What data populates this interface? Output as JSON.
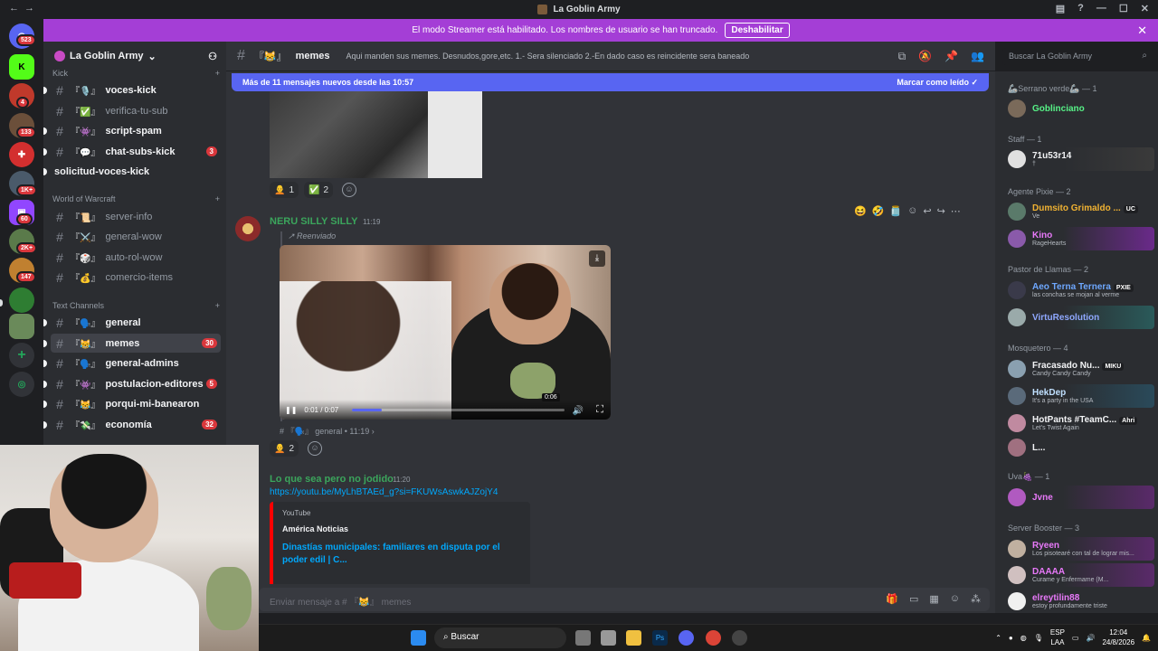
{
  "window": {
    "title": "La Goblin Army"
  },
  "banner": {
    "text": "El modo Streamer está habilitado. Los nombres de usuario se han truncado.",
    "button": "Deshabilitar"
  },
  "servers": [
    {
      "badge": "523",
      "color": "#5865f2"
    },
    {
      "badge": "",
      "color": "#53fc18"
    },
    {
      "badge": "4",
      "color": "#c0392b"
    },
    {
      "badge": "133",
      "color": "#6b4f3a"
    },
    {
      "badge": "",
      "color": "#d32f2f"
    },
    {
      "badge": "1K+",
      "color": "#4a5a6a"
    },
    {
      "badge": "60",
      "color": "#9146ff"
    },
    {
      "badge": "2K+",
      "color": "#5a7a4a"
    },
    {
      "badge": "147",
      "color": "#c08030"
    },
    {
      "badge": "",
      "color": "#2e7d32"
    },
    {
      "badge": "",
      "color": "#6a8a5a"
    }
  ],
  "guild": {
    "name": "La Goblin Army"
  },
  "sidebar": {
    "cat_kick": "Kick",
    "cat_wow": "World of Warcraft",
    "cat_text": "Text Channels",
    "channels": [
      {
        "emoji": "『🎙️』",
        "name": "voces-kick",
        "count": ""
      },
      {
        "emoji": "『✅』",
        "name": "verifica-tu-sub",
        "count": ""
      },
      {
        "emoji": "『👾』",
        "name": "script-spam",
        "count": ""
      },
      {
        "emoji": "『💬』",
        "name": "chat-subs-kick",
        "count": "3"
      },
      {
        "emoji": "",
        "name": "solicitud-voces-kick",
        "count": ""
      },
      {
        "emoji": "『📜』",
        "name": "server-info",
        "count": ""
      },
      {
        "emoji": "『⚔️』",
        "name": "general-wow",
        "count": ""
      },
      {
        "emoji": "『🎲』",
        "name": "auto-rol-wow",
        "count": ""
      },
      {
        "emoji": "『💰』",
        "name": "comercio-items",
        "count": ""
      },
      {
        "emoji": "『🗣️』",
        "name": "general",
        "count": ""
      },
      {
        "emoji": "『😹』",
        "name": "memes",
        "count": "30"
      },
      {
        "emoji": "『🗣️』",
        "name": "general-admins",
        "count": ""
      },
      {
        "emoji": "『👾』",
        "name": "postulacion-editores",
        "count": "5"
      },
      {
        "emoji": "『😹』",
        "name": "porqui-mi-banearon",
        "count": ""
      },
      {
        "emoji": "『💸』",
        "name": "economía",
        "count": "32"
      }
    ]
  },
  "channel_header": {
    "emoji": "『😹』",
    "name": "memes",
    "topic": "Aqui manden sus memes. Desnudos,gore,etc. 1.- Sera silenciado 2.-En dado caso es reincidente sera baneado",
    "search_placeholder": "Buscar La Goblin Army"
  },
  "new_messages": {
    "text": "Más de 11 mensajes nuevos desde las 10:57",
    "action": "Marcar como leído"
  },
  "messages": {
    "m1_reactions": [
      {
        "emoji": "🧑‍🦲",
        "count": "1"
      },
      {
        "emoji": "✅",
        "count": "2"
      }
    ],
    "m2": {
      "author": "NERU SILLY SILLY",
      "author_color": "#3ba55c",
      "time": "11:19",
      "forwarded": "Reenviado",
      "video_time": "0:01 / 0:07",
      "video_progress": 0.14,
      "video_tooltip": "0:06",
      "source_channel": "general",
      "source_time": "11:19",
      "reaction_count": "2"
    },
    "m3": {
      "author": "Lo que sea pero no jodido",
      "author_color": "#3ba55c",
      "time": "11:20",
      "link": "https://youtu.be/MyLhBTAEd_g?si=FKUWsAswkAJZojY4",
      "embed_provider": "YouTube",
      "embed_author": "América Noticias",
      "embed_title": "Dinastías municipales: familiares en disputa por el poder edil | C..."
    }
  },
  "composer": {
    "placeholder": "Enviar mensaje a # 『😹』 memes"
  },
  "members": {
    "groups": [
      {
        "title": "🦾Serrano verde🦾 — 1",
        "members": [
          {
            "name": "Goblinciano",
            "color": "#57f287",
            "status": "",
            "tag": ""
          }
        ]
      },
      {
        "title": "Staff — 1",
        "members": [
          {
            "name": "71u53r14",
            "color": "#f2f3f5",
            "status": "†",
            "tag": ""
          }
        ]
      },
      {
        "title": "Agente Pixie — 2",
        "members": [
          {
            "name": "Dumsito Grimaldo ...",
            "color": "#f0b232",
            "status": "Ve",
            "tag": "UC"
          },
          {
            "name": "Kino",
            "color": "#e879f9",
            "status": "RageHearts",
            "tag": ""
          }
        ]
      },
      {
        "title": "Pastor de Llamas — 2",
        "members": [
          {
            "name": "Aeo Terna Ternera",
            "color": "#6ea8ff",
            "status": "las conchas se mojan al verme",
            "tag": "PXIE"
          },
          {
            "name": "VirtuResolution",
            "color": "#8fa8ff",
            "status": "",
            "tag": ""
          }
        ]
      },
      {
        "title": "Mosquetero — 4",
        "members": [
          {
            "name": "Fracasado Nu...",
            "color": "#f2f3f5",
            "status": "Candy Candy Candy",
            "tag": "MIKU"
          },
          {
            "name": "HekDep",
            "color": "#c0e0ff",
            "status": "It's a party in the USA",
            "tag": ""
          },
          {
            "name": "HotPants #TeamC...",
            "color": "#f2f3f5",
            "status": "Let's Twist Again",
            "tag": "Ahri"
          },
          {
            "name": "L...",
            "color": "#f2f3f5",
            "status": "",
            "tag": ""
          }
        ]
      },
      {
        "title": "Uva🍇 — 1",
        "members": [
          {
            "name": "Jvne",
            "color": "#e879f9",
            "status": "",
            "tag": ""
          }
        ]
      },
      {
        "title": "Server Booster — 3",
        "members": [
          {
            "name": "Ryeen",
            "color": "#e879f9",
            "status": "Los pisotearé con tal de lograr mis...",
            "tag": ""
          },
          {
            "name": "DAAAA",
            "color": "#e879f9",
            "status": "Curame y Enfermame (M...",
            "tag": ""
          },
          {
            "name": "elreytilin88",
            "color": "#e879f9",
            "status": "estoy profundamente triste",
            "tag": ""
          }
        ]
      }
    ]
  },
  "taskbar": {
    "search": "Buscar",
    "lang": "ESP",
    "lang2": "LAA",
    "time": "12:04",
    "date": "24/8/2026"
  }
}
